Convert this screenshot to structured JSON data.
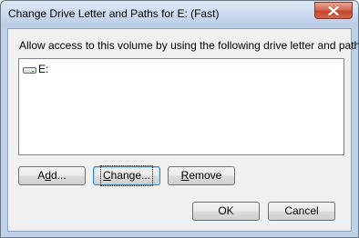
{
  "window": {
    "title": "Change Drive Letter and Paths for E: (Fast)",
    "close_icon": "close-icon"
  },
  "dialog": {
    "prompt": "Allow access to this volume by using the following drive letter and paths:",
    "list": {
      "items": [
        {
          "icon": "drive-icon",
          "label": "E:"
        }
      ]
    },
    "buttons": {
      "add": {
        "mnemonic": "d",
        "pre": "A",
        "post": "d..."
      },
      "change": {
        "mnemonic": "C",
        "pre": "",
        "post": "hange..."
      },
      "remove": {
        "mnemonic": "R",
        "pre": "",
        "post": "emove"
      },
      "ok": "OK",
      "cancel": "Cancel"
    }
  }
}
